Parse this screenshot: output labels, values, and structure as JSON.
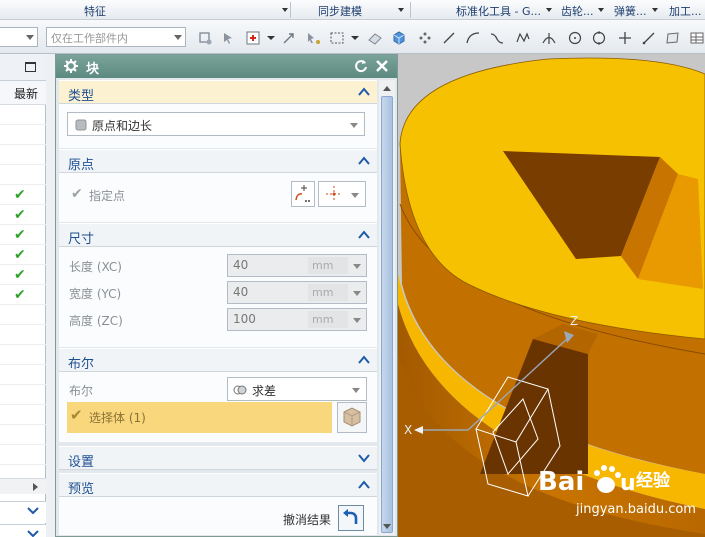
{
  "menu": {
    "feature": "特征",
    "sync_model": "同步建模",
    "std_tools": "标准化工具 - G...",
    "gear": "齿轮...",
    "spring": "弹簧...",
    "machining": "加工..."
  },
  "toolbar": {
    "filter_placeholder": "仅在工作部件内"
  },
  "left_panel": {
    "column_header": "最新",
    "checks": [
      "✔",
      "✔",
      "✔",
      "✔",
      "✔",
      "✔"
    ]
  },
  "dialog": {
    "title": "块",
    "type_section": {
      "label": "类型",
      "type_value": "原点和边长"
    },
    "origin_section": {
      "label": "原点",
      "specify_point": "指定点"
    },
    "dimensions_section": {
      "label": "尺寸",
      "length_label": "长度 (XC)",
      "length_value": "40",
      "width_label": "宽度 (YC)",
      "width_value": "40",
      "height_label": "高度 (ZC)",
      "height_value": "100",
      "unit": "mm"
    },
    "boolean_section": {
      "label": "布尔",
      "boolean_label": "布尔",
      "boolean_value": "求差",
      "select_body": "选择体 (1)"
    },
    "settings_section": {
      "label": "设置"
    },
    "preview_section": {
      "label": "预览",
      "undo_result": "撤消结果"
    }
  },
  "viewport": {
    "axis_z": "Z",
    "axis_x": "X",
    "watermark_text": "经验",
    "watermark_url": "jingyan.baidu.com",
    "body_color": "#f4b400",
    "background": "#c7c7c7"
  },
  "colors": {
    "title_bar": "#6a958b",
    "section_label": "#1e4f93",
    "selection_highlight": "#f9d77d"
  }
}
